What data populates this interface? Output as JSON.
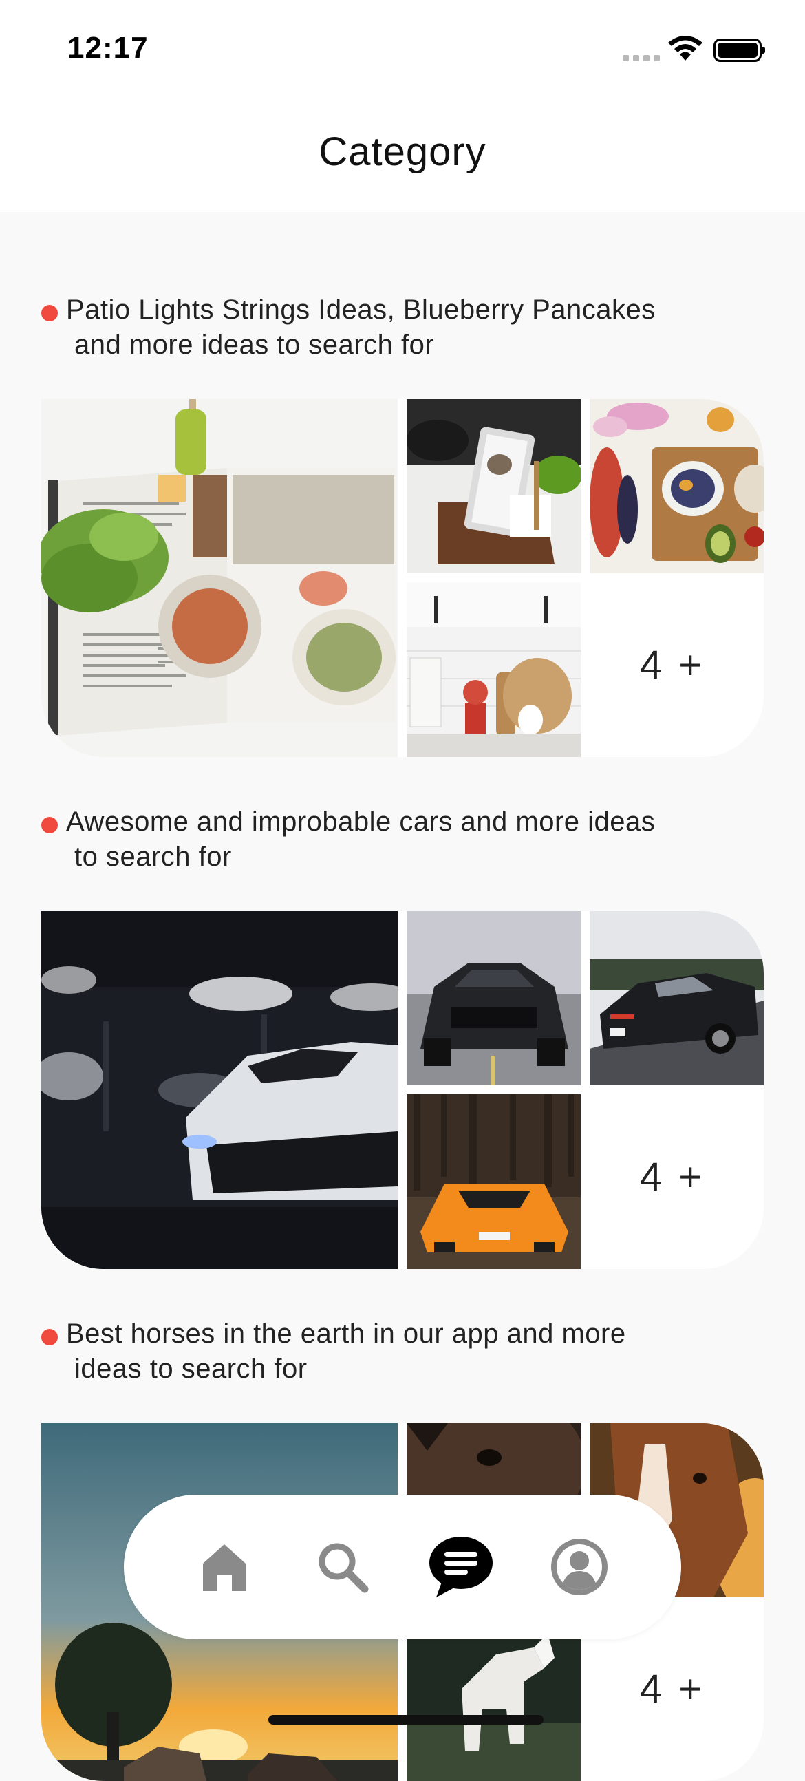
{
  "status_bar": {
    "time": "12:17"
  },
  "header": {
    "title": "Category"
  },
  "sections": [
    {
      "caption_line1": "Patio Lights Strings Ideas, Blueberry Pancakes",
      "caption_line2": "and more ideas to search for",
      "more_label": "4 +",
      "images": [
        "cookbook-photo",
        "tablet-recipe-stand-photo",
        "fruit-breakfast-bowls-photo",
        "kitchen-counter-photo"
      ]
    },
    {
      "caption_line1": "Awesome and improbable cars and more ideas",
      "caption_line2": "to search for",
      "more_label": "4 +",
      "images": [
        "white-sports-car-garage-photo",
        "black-muscle-car-photo",
        "black-sedan-road-photo",
        "orange-supercar-forest-photo"
      ]
    },
    {
      "caption_line1": "Best horses in the earth in our app and more",
      "caption_line2": "ideas to search for",
      "more_label": "4 +",
      "images": [
        "horses-sunset-photo",
        "horse-head-closeup-photo",
        "chestnut-horse-photo",
        "white-horse-photo"
      ]
    }
  ],
  "bottom_nav": {
    "items": [
      {
        "icon": "home-icon",
        "active": false
      },
      {
        "icon": "search-icon",
        "active": false
      },
      {
        "icon": "chat-icon",
        "active": true
      },
      {
        "icon": "profile-icon",
        "active": false
      }
    ]
  },
  "colors": {
    "accent_dot": "#f04a3f",
    "background": "#f9f9f9",
    "active_icon": "#000000",
    "inactive_icon": "#8a8a8a"
  }
}
